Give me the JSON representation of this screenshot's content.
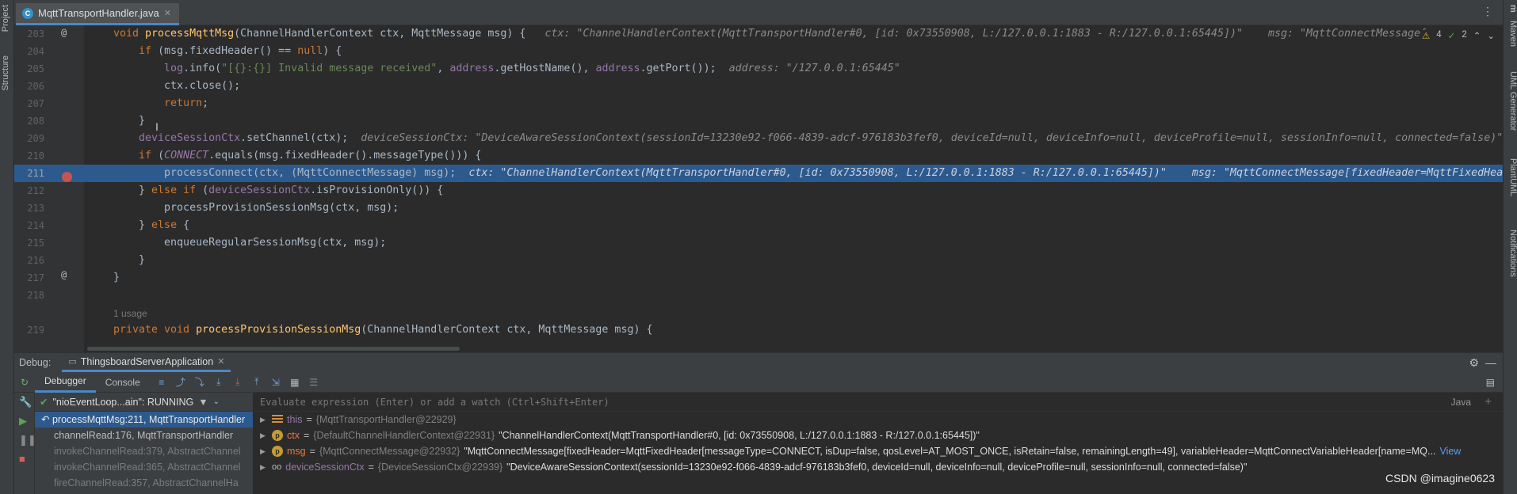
{
  "left_strip": {
    "project_label": "Project",
    "structure_label": "Structure"
  },
  "right_strip": {
    "maven_label": "Maven",
    "uml_label": "UML Generator",
    "plantuml_label": "PlantUML",
    "notifications_label": "Notifications",
    "m_label": "m"
  },
  "tab": {
    "filename": "MqttTransportHandler.java"
  },
  "inspections": {
    "warnings": "4",
    "ok": "2"
  },
  "editor": {
    "lines": [
      {
        "num": "203",
        "tokens": [
          [
            "kw",
            "void "
          ],
          [
            "fn",
            "processMqttMsg"
          ],
          [
            "p",
            "(ChannelHandlerContext ctx, MqttMessage msg) {   "
          ],
          [
            "inl",
            "ctx: \"ChannelHandlerContext(MqttTransportHandler#0, [id: 0x73550908, L:/127.0.0.1:1883 - R:/127.0.0.1:65445])\"    msg: \"MqttConnectMessage["
          ]
        ]
      },
      {
        "num": "204",
        "tokens": [
          [
            "p",
            "    "
          ],
          [
            "kw",
            "if "
          ],
          [
            "p",
            "(msg.fixedHeader() == "
          ],
          [
            "kw",
            "null"
          ],
          [
            "p",
            ") {"
          ]
        ]
      },
      {
        "num": "205",
        "tokens": [
          [
            "p",
            "        "
          ],
          [
            "fld",
            "log"
          ],
          [
            "p",
            ".info("
          ],
          [
            "str",
            "\"[{}:{}] Invalid message received\""
          ],
          [
            "p",
            ", "
          ],
          [
            "fld",
            "address"
          ],
          [
            "p",
            ".getHostName(), "
          ],
          [
            "fld",
            "address"
          ],
          [
            "p",
            ".getPort());  "
          ],
          [
            "inl",
            "address: \"/127.0.0.1:65445\""
          ]
        ]
      },
      {
        "num": "206",
        "tokens": [
          [
            "p",
            "        ctx.close();"
          ]
        ]
      },
      {
        "num": "207",
        "tokens": [
          [
            "p",
            "        "
          ],
          [
            "kw",
            "return"
          ],
          [
            "p",
            ";"
          ]
        ]
      },
      {
        "num": "208",
        "tokens": [
          [
            "p",
            "    }"
          ]
        ]
      },
      {
        "num": "209",
        "tokens": [
          [
            "p",
            "    "
          ],
          [
            "fld",
            "deviceSessionCtx"
          ],
          [
            "p",
            ".setChannel(ctx);  "
          ],
          [
            "inl",
            "deviceSessionCtx: \"DeviceAwareSessionContext(sessionId=13230e92-f066-4839-adcf-976183b3fef0, deviceId=null, deviceInfo=null, deviceProfile=null, sessionInfo=null, connected=false)\""
          ]
        ]
      },
      {
        "num": "210",
        "tokens": [
          [
            "p",
            "    "
          ],
          [
            "kw",
            "if "
          ],
          [
            "p",
            "("
          ],
          [
            "cst",
            "CONNECT"
          ],
          [
            "p",
            ".equals(msg.fixedHeader().messageType())) {"
          ]
        ]
      },
      {
        "num": "211",
        "tokens": [
          [
            "p",
            "        processConnect(ctx, (MqttConnectMessage) msg);  "
          ],
          [
            "inl",
            "ctx: \"ChannelHandlerContext(MqttTransportHandler#0, [id: 0x73550908, L:/127.0.0.1:1883 - R:/127.0.0.1:65445])\"    msg: \"MqttConnectMessage[fixedHeader=MqttFixedHea"
          ]
        ]
      },
      {
        "num": "212",
        "tokens": [
          [
            "p",
            "    } "
          ],
          [
            "kw",
            "else if "
          ],
          [
            "p",
            "("
          ],
          [
            "fld",
            "deviceSessionCtx"
          ],
          [
            "p",
            ".isProvisionOnly()) {"
          ]
        ]
      },
      {
        "num": "213",
        "tokens": [
          [
            "p",
            "        processProvisionSessionMsg(ctx, msg);"
          ]
        ]
      },
      {
        "num": "214",
        "tokens": [
          [
            "p",
            "    } "
          ],
          [
            "kw",
            "else "
          ],
          [
            "p",
            "{"
          ]
        ]
      },
      {
        "num": "215",
        "tokens": [
          [
            "p",
            "        enqueueRegularSessionMsg(ctx, msg);"
          ]
        ]
      },
      {
        "num": "216",
        "tokens": [
          [
            "p",
            "    }"
          ]
        ]
      },
      {
        "num": "217",
        "tokens": [
          [
            "p",
            "}"
          ]
        ]
      },
      {
        "num": "218",
        "tokens": []
      },
      {
        "num": "219",
        "tokens": [
          [
            "kw",
            "private void "
          ],
          [
            "fn",
            "processProvisionSessionMsg"
          ],
          [
            "p",
            "(ChannelHandlerContext ctx, MqttMessage msg) {"
          ]
        ]
      }
    ],
    "usage_label": "1 usage"
  },
  "debug": {
    "title": "Debug:",
    "app_tab": "ThingsboardServerApplication",
    "tab_debugger": "Debugger",
    "tab_console": "Console",
    "thread": "\"nioEventLoop...ain\": RUNNING",
    "frames": [
      {
        "text": "processMqttMsg:211, MqttTransportHandler",
        "state": "sel"
      },
      {
        "text": "channelRead:176, MqttTransportHandler",
        "state": "normal"
      },
      {
        "text": "invokeChannelRead:379, AbstractChannel",
        "state": "dim"
      },
      {
        "text": "invokeChannelRead:365, AbstractChannel",
        "state": "dim"
      },
      {
        "text": "fireChannelRead:357, AbstractChannelHa",
        "state": "dim"
      }
    ],
    "eval_placeholder": "Evaluate expression (Enter) or add a watch (Ctrl+Shift+Enter)",
    "lang": "Java",
    "variables": [
      {
        "icon": "bars",
        "name": "this",
        "type": "{MqttTransportHandler@22929}",
        "value": "",
        "kind": "field"
      },
      {
        "icon": "p",
        "name": "ctx",
        "type": "{DefaultChannelHandlerContext@22931}",
        "value": "\"ChannelHandlerContext(MqttTransportHandler#0, [id: 0x73550908, L:/127.0.0.1:1883 - R:/127.0.0.1:65445])\"",
        "kind": "param"
      },
      {
        "icon": "p",
        "name": "msg",
        "type": "{MqttConnectMessage@22932}",
        "value": "\"MqttConnectMessage[fixedHeader=MqttFixedHeader[messageType=CONNECT, isDup=false, qosLevel=AT_MOST_ONCE, isRetain=false, remainingLength=49], variableHeader=MqttConnectVariableHeader[name=MQ...",
        "kind": "param",
        "link": "View"
      },
      {
        "icon": "oo",
        "name": "deviceSessionCtx",
        "type": "{DeviceSessionCtx@22939}",
        "value": "\"DeviceAwareSessionContext(sessionId=13230e92-f066-4839-adcf-976183b3fef0, deviceId=null, deviceInfo=null, deviceProfile=null, sessionInfo=null, connected=false)\"",
        "kind": "field"
      }
    ]
  },
  "watermark": "CSDN @imagine0623"
}
